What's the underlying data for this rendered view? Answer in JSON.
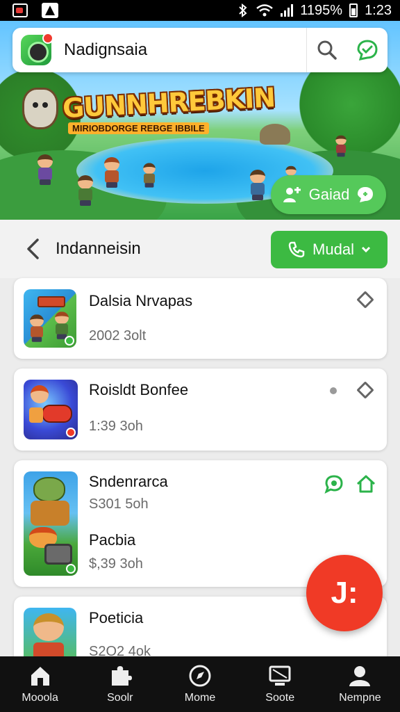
{
  "status_bar": {
    "battery": "1195%",
    "time": "1:23"
  },
  "banner": {
    "game_title": "GUNNHREBKIN",
    "game_subtitle": "MIRIOBDORGE REBGE IBBILE",
    "button_label": "Gaiad"
  },
  "search": {
    "title": "Nadignsaia"
  },
  "section": {
    "title": "Indanneisin",
    "button_label": "Mudal"
  },
  "items": [
    {
      "title": "Dalsia Nrvapas",
      "meta": "2002 3olt"
    },
    {
      "title": "Roisldt Bonfee",
      "meta": "1:39 3oh"
    },
    {
      "title": "Sndenrarca",
      "meta": "S301 5oh",
      "title2": "Pacbia",
      "meta2": "$,39 3oh"
    },
    {
      "title": "Poeticia",
      "meta": "S2O2 4ok"
    }
  ],
  "fab": {
    "label": "J:"
  },
  "bottom_nav": [
    {
      "label": "Mooola",
      "icon": "home-icon"
    },
    {
      "label": "Soolr",
      "icon": "puzzle-icon"
    },
    {
      "label": "Mome",
      "icon": "compass-icon"
    },
    {
      "label": "Soote",
      "icon": "monitor-icon"
    },
    {
      "label": "Nempne",
      "icon": "person-icon"
    }
  ],
  "colors": {
    "accent_green": "#3cba42",
    "fab_red": "#f03a26",
    "nav_bg": "#111111"
  }
}
